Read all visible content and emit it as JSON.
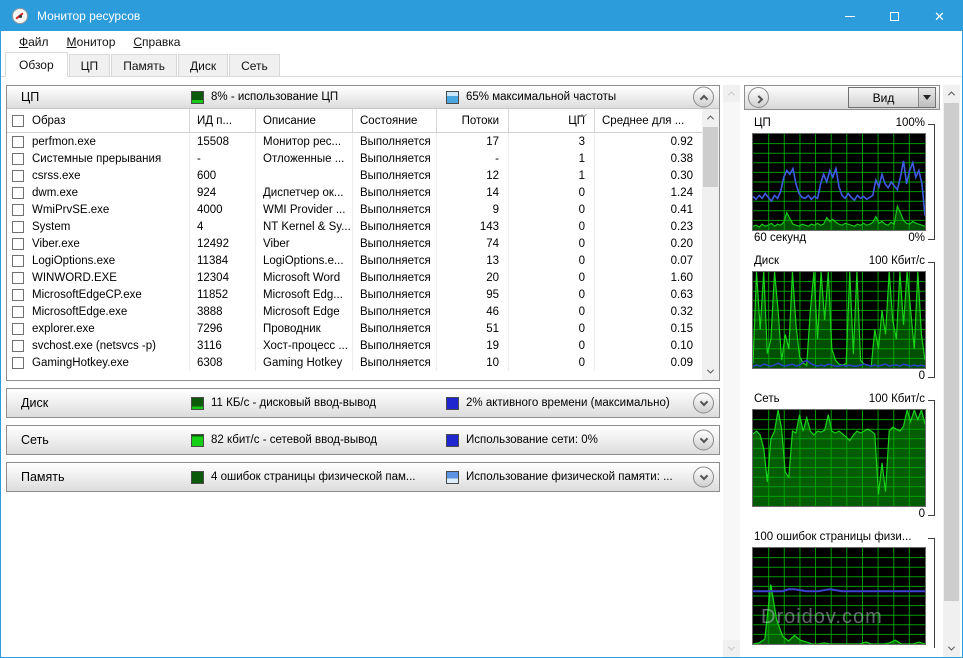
{
  "window": {
    "title": "Монитор ресурсов"
  },
  "menu": {
    "items": [
      {
        "hot": "Ф",
        "rest": "айл"
      },
      {
        "hot": "М",
        "rest": "онитор"
      },
      {
        "hot": "С",
        "rest": "правка"
      }
    ]
  },
  "tabs": [
    {
      "label": "Обзор",
      "active": true
    },
    {
      "label": "ЦП",
      "active": false
    },
    {
      "label": "Память",
      "active": false
    },
    {
      "label": "Диск",
      "active": false
    },
    {
      "label": "Сеть",
      "active": false
    }
  ],
  "sections": {
    "cpu": {
      "title": "ЦП",
      "legend_green": "8% - использование ЦП",
      "legend_blue": "65% максимальной частоты"
    },
    "disk": {
      "title": "Диск",
      "legend_green": "11 КБ/с - дисковый ввод-вывод",
      "legend_blue": "2% активного времени (максимально)"
    },
    "network": {
      "title": "Сеть",
      "legend_green": "82 кбит/с - сетевой ввод-вывод",
      "legend_blue": "Использование сети: 0%"
    },
    "memory": {
      "title": "Память",
      "legend_green": "4 ошибок страницы физической пам...",
      "legend_blue": "Использование физической памяти: ..."
    }
  },
  "legend_styles": {
    "cpu_green": "background:linear-gradient(180deg,#0b5a0b 0%,#0b5a0b 72%,#18c818 72%)",
    "cpu_blue": "background:linear-gradient(180deg,#c8e6f8 0%,#c8e6f8 35%,#4aa6e0 35%)",
    "disk_green": "background:linear-gradient(180deg,#0b5a0b 0%,#0b5a0b 78%,#18c818 78%)",
    "disk_blue": "background:#1f25cf",
    "net_green": "background:linear-gradient(180deg,#0b5a0b 0%,#0b5a0b 12%,#16d016 12%)",
    "net_blue": "background:#1f25cf",
    "mem_green": "background:#0b5a0b",
    "mem_blue": "background:linear-gradient(180deg,#5e93e2 0%,#5e93e2 58%,#dceefb 58%)"
  },
  "table": {
    "headers": [
      "Образ",
      "ИД п...",
      "Описание",
      "Состояние",
      "Потоки",
      "ЦП",
      "Среднее для ..."
    ],
    "rows": [
      [
        "perfmon.exe",
        "15508",
        "Монитор рес...",
        "Выполняется",
        "17",
        "3",
        "0.92"
      ],
      [
        "Системные прерывания",
        "-",
        "Отложенные ...",
        "Выполняется",
        "-",
        "1",
        "0.38"
      ],
      [
        "csrss.exe",
        "600",
        "",
        "Выполняется",
        "12",
        "1",
        "0.30"
      ],
      [
        "dwm.exe",
        "924",
        "Диспетчер ок...",
        "Выполняется",
        "14",
        "0",
        "1.24"
      ],
      [
        "WmiPrvSE.exe",
        "4000",
        "WMI Provider ...",
        "Выполняется",
        "9",
        "0",
        "0.41"
      ],
      [
        "System",
        "4",
        "NT Kernel & Sy...",
        "Выполняется",
        "143",
        "0",
        "0.23"
      ],
      [
        "Viber.exe",
        "12492",
        "Viber",
        "Выполняется",
        "74",
        "0",
        "0.20"
      ],
      [
        "LogiOptions.exe",
        "11384",
        "LogiOptions.e...",
        "Выполняется",
        "13",
        "0",
        "0.07"
      ],
      [
        "WINWORD.EXE",
        "12304",
        "Microsoft Word",
        "Выполняется",
        "20",
        "0",
        "1.60"
      ],
      [
        "MicrosoftEdgeCP.exe",
        "11852",
        "Microsoft Edg...",
        "Выполняется",
        "95",
        "0",
        "0.63"
      ],
      [
        "MicrosoftEdge.exe",
        "3888",
        "Microsoft Edge",
        "Выполняется",
        "46",
        "0",
        "0.32"
      ],
      [
        "explorer.exe",
        "7296",
        "Проводник",
        "Выполняется",
        "51",
        "0",
        "0.15"
      ],
      [
        "svchost.exe (netsvcs -p)",
        "3116",
        "Хост-процесс ...",
        "Выполняется",
        "19",
        "0",
        "0.10"
      ],
      [
        "GamingHotkey.exe",
        "6308",
        "Gaming Hotkey",
        "Выполняется",
        "10",
        "0",
        "0.09"
      ]
    ]
  },
  "right_panel": {
    "view_button": "Вид",
    "graphs": [
      {
        "id": "cpu",
        "title": "ЦП",
        "top_right": "100%",
        "bottom_left": "60 секунд",
        "bottom_right": "0%",
        "series": [
          {
            "name": "использование ЦП",
            "fill": "#004e00",
            "color": "#18c818",
            "width": 1.2,
            "values": [
              4,
              5,
              3,
              6,
              4,
              5,
              7,
              4,
              6,
              5,
              8,
              18,
              12,
              6,
              5,
              4,
              6,
              5,
              4,
              6,
              5,
              7,
              5,
              6,
              13,
              9,
              11,
              8,
              6,
              5,
              7,
              6,
              5,
              4,
              6,
              5,
              7,
              5,
              6,
              8,
              14,
              7,
              9,
              6,
              5,
              8,
              6,
              25,
              18,
              10,
              7,
              6,
              9,
              7,
              6,
              5,
              4
            ]
          },
          {
            "name": "частота ЦП",
            "color": "#3c5be0",
            "width": 1.6,
            "values": [
              35,
              32,
              36,
              33,
              38,
              34,
              30,
              36,
              33,
              40,
              55,
              62,
              58,
              64,
              48,
              38,
              34,
              33,
              36,
              32,
              35,
              33,
              48,
              58,
              50,
              62,
              55,
              64,
              45,
              36,
              33,
              38,
              34,
              31,
              36,
              33,
              35,
              32,
              34,
              36,
              52,
              45,
              58,
              48,
              44,
              50,
              46,
              42,
              55,
              72,
              48,
              62,
              70,
              55,
              62,
              48,
              15
            ]
          }
        ]
      },
      {
        "id": "disk",
        "title": "Диск",
        "top_right": "100 Кбит/с",
        "bottom_left": "",
        "bottom_right": "0",
        "series": [
          {
            "name": "дисковый ввод-вывод",
            "fill": "#014f01",
            "color": "#18d418",
            "width": 1.2,
            "values": [
              5,
              100,
              40,
              100,
              15,
              30,
              100,
              60,
              8,
              35,
              20,
              100,
              45,
              12,
              5,
              3,
              60,
              100,
              30,
              100,
              50,
              100,
              20,
              8,
              4,
              3,
              5,
              100,
              15,
              100,
              8,
              4,
              3,
              2,
              40,
              20,
              60,
              35,
              100,
              50,
              30,
              100,
              45,
              100,
              60,
              20,
              100,
              35,
              8
            ]
          },
          {
            "name": "активное время",
            "color": "#2f3fd0",
            "width": 1.5,
            "values": [
              2,
              3,
              2,
              4,
              3,
              2,
              3,
              5,
              3,
              2,
              3,
              4,
              2,
              3,
              6,
              8,
              5,
              3,
              2,
              3,
              2,
              4,
              3,
              2,
              2,
              3,
              2,
              3,
              2,
              2,
              3,
              4,
              3,
              2,
              3,
              2,
              3,
              4,
              2,
              3,
              3,
              2,
              4,
              3,
              2,
              3,
              2,
              3,
              2
            ]
          }
        ]
      },
      {
        "id": "network",
        "title": "Сеть",
        "top_right": "100 Кбит/с",
        "bottom_left": "",
        "bottom_right": "0",
        "series": [
          {
            "name": "сетевой ввод-вывод",
            "fill": "#045c04",
            "color": "#18d418",
            "width": 1.2,
            "values": [
              75,
              78,
              74,
              60,
              25,
              70,
              78,
              100,
              80,
              35,
              30,
              78,
              76,
              95,
              78,
              92,
              78,
              74,
              78,
              77,
              79,
              95,
              78,
              76,
              78,
              75,
              72,
              68,
              74,
              78,
              76,
              78,
              80,
              78,
              75,
              12,
              45,
              15,
              78,
              82,
              80,
              78,
              83,
              100,
              88,
              100,
              90,
              100,
              85
            ]
          }
        ]
      },
      {
        "id": "memory",
        "title": "100 ошибок страницы физи...",
        "top_right": "",
        "bottom_left": "",
        "bottom_right": "",
        "series": [
          {
            "name": "ошибки страницы",
            "fill": "#045c04",
            "color": "#18d418",
            "width": 1.2,
            "values": [
              0,
              1,
              5,
              62,
              25,
              8,
              3,
              9,
              4,
              2,
              0,
              0,
              1,
              0,
              0,
              0,
              0,
              0,
              0,
              2,
              0,
              0,
              0,
              1,
              4,
              0,
              0,
              0,
              2,
              0
            ]
          },
          {
            "name": "используемая память",
            "color": "#3a44cf",
            "width": 2,
            "values": [
              55,
              55,
              55,
              55,
              55,
              55,
              57,
              57,
              56,
              55,
              55,
              55,
              56,
              57,
              56,
              55,
              55,
              55,
              55,
              55,
              55,
              55,
              55,
              55,
              55,
              55,
              55,
              55,
              55,
              55
            ]
          }
        ]
      }
    ]
  },
  "watermark": "Droidov.com",
  "colors": {
    "titlebar": "#2d9cdb",
    "graph_grid": "#00a400",
    "graph_green": "#18c818",
    "graph_green_fill": "#004e00",
    "graph_blue": "#3c5be0"
  }
}
